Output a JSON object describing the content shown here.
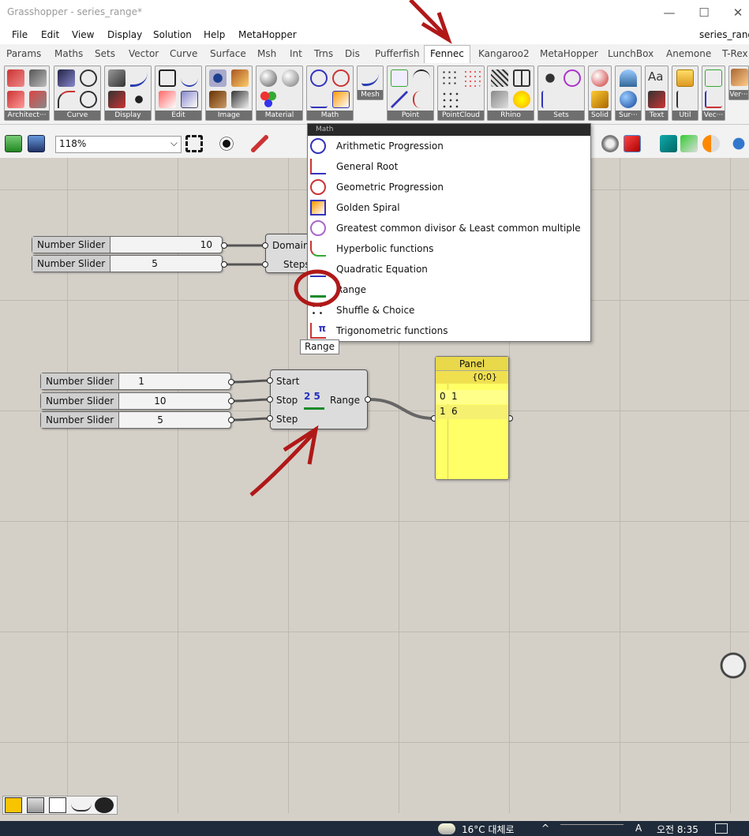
{
  "window": {
    "title": "Grasshopper - series_range*",
    "doc_name": "series_range"
  },
  "menu": [
    "File",
    "Edit",
    "View",
    "Display",
    "Solution",
    "Help",
    "MetaHopper"
  ],
  "tabs": [
    "Params",
    "Maths",
    "Sets",
    "Vector",
    "Curve",
    "Surface",
    "Msh",
    "Int",
    "Trns",
    "Dis",
    "Pufferfish",
    "Fennec",
    "Kangaroo2",
    "MetaHopper",
    "LunchBox",
    "Anemone",
    "T-Rex"
  ],
  "active_tab": "Fennec",
  "ribbon_groups": [
    "Architect···",
    "Curve",
    "Display",
    "Edit",
    "Image",
    "Material",
    "Math",
    "Point",
    "PointCloud",
    "Rhino",
    "Sets",
    "Solid",
    "Sur···",
    "Text",
    "Util",
    "Vec···",
    "Ver···"
  ],
  "ribbon_labels": {
    "mesh": "Mesh"
  },
  "zoom": "118%",
  "dropdown": {
    "header": "Math",
    "items": [
      {
        "label": "Arithmetic Progression",
        "icon": "arithmetic-progression-icon"
      },
      {
        "label": "General Root",
        "icon": "general-root-icon"
      },
      {
        "label": "Geometric Progression",
        "icon": "geometric-progression-icon"
      },
      {
        "label": "Golden Spiral",
        "icon": "golden-spiral-icon"
      },
      {
        "label": "Greatest common divisor & Least common multiple",
        "icon": "gcd-lcm-icon"
      },
      {
        "label": "Hyperbolic functions",
        "icon": "hyperbolic-icon"
      },
      {
        "label": "Quadratic Equation",
        "icon": "quadratic-icon"
      },
      {
        "label": "Range",
        "icon": "range-icon"
      },
      {
        "label": "Shuffle & Choice",
        "icon": "shuffle-icon"
      },
      {
        "label": "Trigonometric functions",
        "icon": "trig-icon"
      }
    ]
  },
  "tooltip": "Range",
  "sliders_top": [
    {
      "label": "Number Slider",
      "value": "10"
    },
    {
      "label": "Number Slider",
      "value": "5"
    }
  ],
  "series_comp": {
    "inputs": [
      "Domain",
      "Steps"
    ]
  },
  "sliders_bottom": [
    {
      "label": "Number Slider",
      "value": "1"
    },
    {
      "label": "Number Slider",
      "value": "10"
    },
    {
      "label": "Number Slider",
      "value": "5"
    }
  ],
  "range_comp": {
    "inputs": [
      "Start",
      "Stop",
      "Step"
    ],
    "output": "Range",
    "icon_text": "2 5"
  },
  "panel": {
    "title": "Panel",
    "path": "{0;0}",
    "rows": [
      {
        "index": "0",
        "value": "1"
      },
      {
        "index": "1",
        "value": "6"
      }
    ]
  },
  "taskbar": {
    "weather": "16°C  대체로",
    "time": "오전 8:35"
  },
  "colors": {
    "annotation": "#b01818",
    "panel": "#ffff66",
    "panel_header": "#e8d84a"
  }
}
